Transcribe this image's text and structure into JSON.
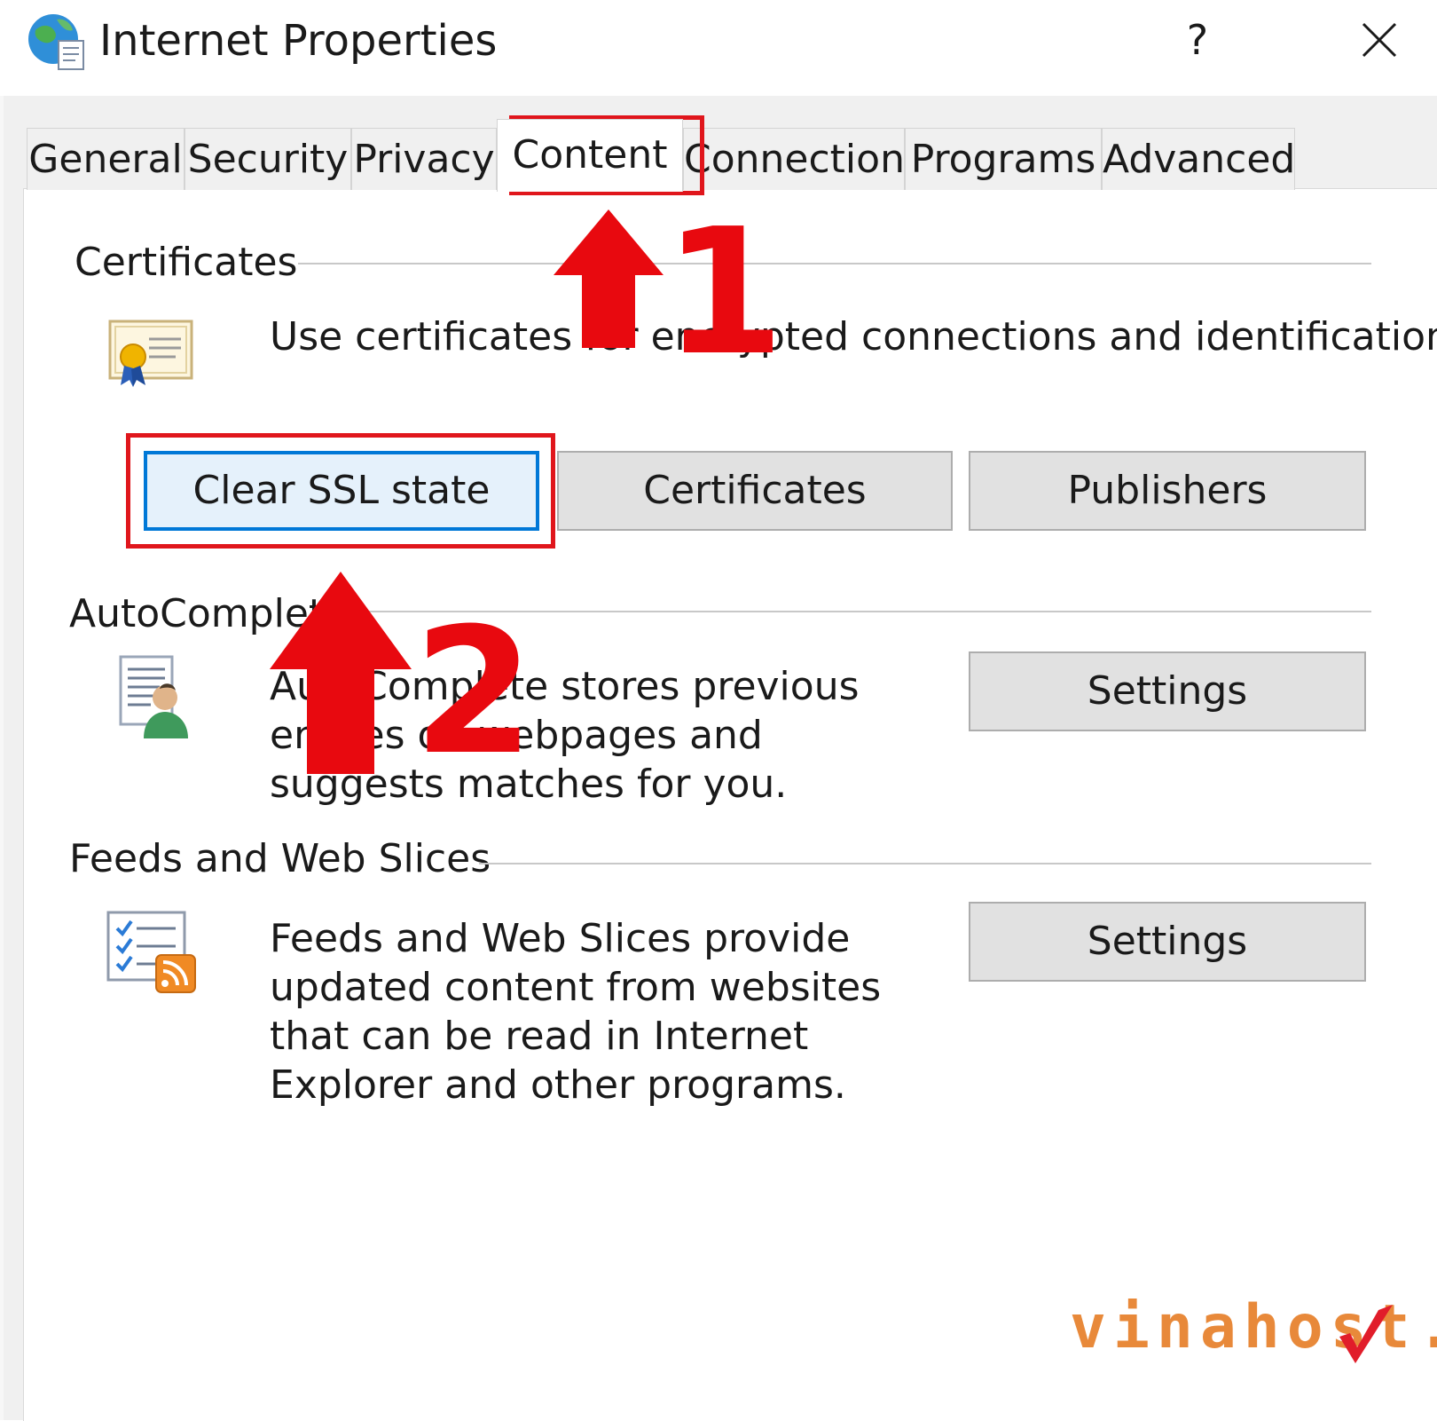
{
  "window": {
    "title": "Internet Properties",
    "help_label": "?"
  },
  "tabs": [
    {
      "label": "General",
      "active": false
    },
    {
      "label": "Security",
      "active": false
    },
    {
      "label": "Privacy",
      "active": false
    },
    {
      "label": "Content",
      "active": true
    },
    {
      "label": "Connections",
      "active": false
    },
    {
      "label": "Programs",
      "active": false
    },
    {
      "label": "Advanced",
      "active": false
    }
  ],
  "certificates": {
    "group_label": "Certificates",
    "description": "Use certificates for encrypted connections and identification.",
    "icon": "certificate-icon",
    "buttons": {
      "clear_ssl": "Clear SSL state",
      "certificates": "Certificates",
      "publishers": "Publishers"
    }
  },
  "autocomplete": {
    "group_label": "AutoComplete",
    "description": "AutoComplete stores previous entries on webpages and suggests matches for you.",
    "icon": "autocomplete-icon",
    "settings_button": "Settings"
  },
  "feeds": {
    "group_label": "Feeds and Web Slices",
    "description": "Feeds and Web Slices provide updated content from websites that can be read in Internet Explorer and other programs.",
    "icon": "rss-feed-icon",
    "settings_button": "Settings"
  },
  "annotations": {
    "step1": "1",
    "step2": "2",
    "color": "#e8090f"
  },
  "watermark": {
    "text": "vinahost.",
    "color": "#e8893a"
  },
  "colors": {
    "focus_border": "#0078d7",
    "highlight": "#e0161c"
  }
}
